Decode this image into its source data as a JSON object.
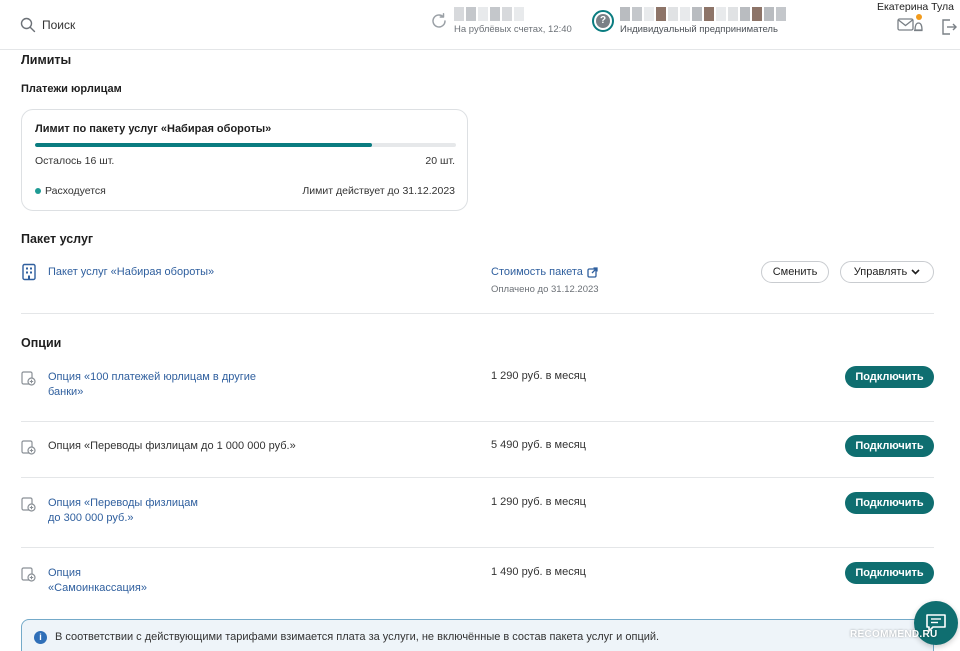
{
  "header": {
    "search_label": "Поиск",
    "balance_caption": "На рублёвых счетах, 12:40",
    "company_caption": "Индивидуальный предприниматель",
    "company_status_glyph": "?",
    "user_name": "Екатерина Тула",
    "icons": [
      "search-icon",
      "refresh-icon",
      "mail-bell-icon",
      "logout-icon"
    ],
    "accent_color": "#0a7c80",
    "notification_color": "#f29b1d"
  },
  "limits": {
    "heading": "Лимиты",
    "subheading": "Платежи юрлицам",
    "card": {
      "title": "Лимит по пакету услуг «Набирая обороты»",
      "progress_fraction": 0.8,
      "remaining": "Осталось 16 шт.",
      "total": "20 шт.",
      "status": "Расходуется",
      "valid_until": "Лимит действует до 31.12.2023"
    }
  },
  "package": {
    "heading": "Пакет услуг",
    "name": "Пакет услуг «Набирая обороты»",
    "cost_link": "Стоимость пакета",
    "paid_until": "Оплачено до 31.12.2023",
    "change_label": "Сменить",
    "manage_label": "Управлять"
  },
  "options": {
    "heading": "Опции",
    "connect_label": "Подключить",
    "items": [
      {
        "name": "Опция «100 платежей юрлицам в другие\nбанки»",
        "price": "1 290 руб. в месяц",
        "is_link": true
      },
      {
        "name": "Опция «Переводы физлицам до 1 000 000 руб.»",
        "price": "5 490 руб. в месяц",
        "is_link": false
      },
      {
        "name": "Опция «Переводы физлицам\nдо 300 000 руб.»",
        "price": "1 290 руб. в месяц",
        "is_link": true
      },
      {
        "name": "Опция\n«Самоинкассация»",
        "price": "1 490 руб. в месяц",
        "is_link": true
      }
    ]
  },
  "info": {
    "text": "В соответствии с действующими тарифами взимается плата за услуги, не включённые в состав пакета услуг и опций."
  },
  "watermark": "RECOMMEND.RU"
}
